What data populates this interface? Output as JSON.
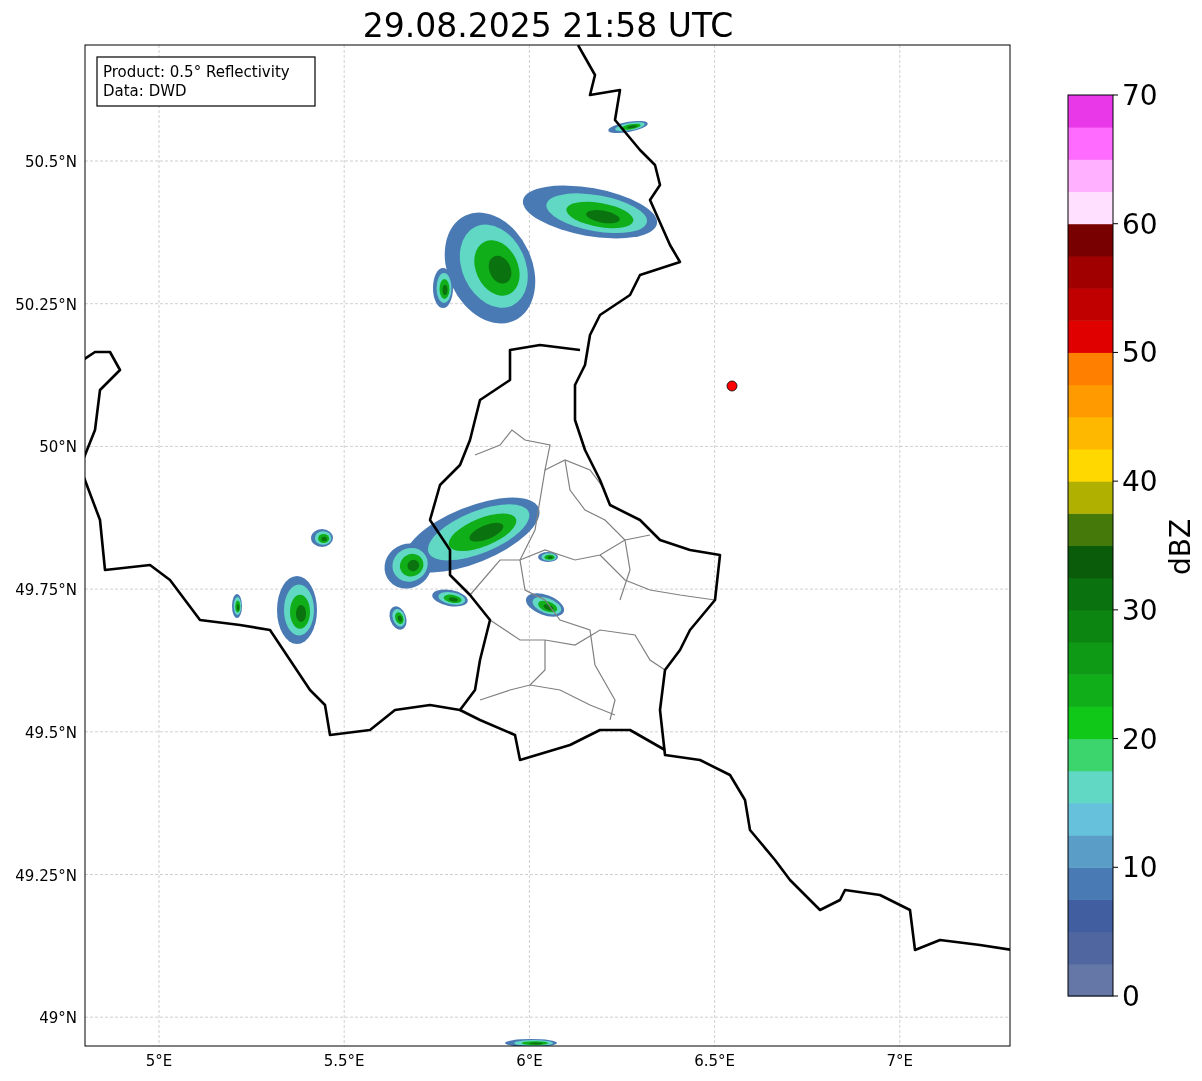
{
  "title": "29.08.2025 21:58 UTC",
  "info_box": [
    "Product: 0.5° Reflectivity",
    "Data: DWD"
  ],
  "lat_ticks": [
    "50.5°N",
    "50.25°N",
    "50°N",
    "49.75°N",
    "49.5°N",
    "49.25°N",
    "49°N"
  ],
  "lon_ticks": [
    "5°E",
    "5.5°E",
    "6°E",
    "6.5°E",
    "7°E"
  ],
  "colorbar": {
    "label": "dBZ",
    "ticks": [
      "70",
      "60",
      "50",
      "40",
      "30",
      "20",
      "10",
      "0"
    ],
    "segments": [
      {
        "color": "#6477a7"
      },
      {
        "color": "#5066a0"
      },
      {
        "color": "#405ea0"
      },
      {
        "color": "#4a7ab4"
      },
      {
        "color": "#5a9ec8"
      },
      {
        "color": "#66c2dc"
      },
      {
        "color": "#60d8c4"
      },
      {
        "color": "#3cd46c"
      },
      {
        "color": "#10c818"
      },
      {
        "color": "#10ae18"
      },
      {
        "color": "#0e9a14"
      },
      {
        "color": "#0c8610"
      },
      {
        "color": "#0a720e"
      },
      {
        "color": "#0a5c0a"
      },
      {
        "color": "#457a0a"
      },
      {
        "color": "#b0b000"
      },
      {
        "color": "#ffd800"
      },
      {
        "color": "#ffb800"
      },
      {
        "color": "#ff9a00"
      },
      {
        "color": "#ff7f00"
      },
      {
        "color": "#e00000"
      },
      {
        "color": "#c00000"
      },
      {
        "color": "#a00000"
      },
      {
        "color": "#780000"
      },
      {
        "color": "#ffe0ff"
      },
      {
        "color": "#ffb0ff"
      },
      {
        "color": "#ff6aff"
      },
      {
        "color": "#e838e8"
      }
    ]
  }
}
